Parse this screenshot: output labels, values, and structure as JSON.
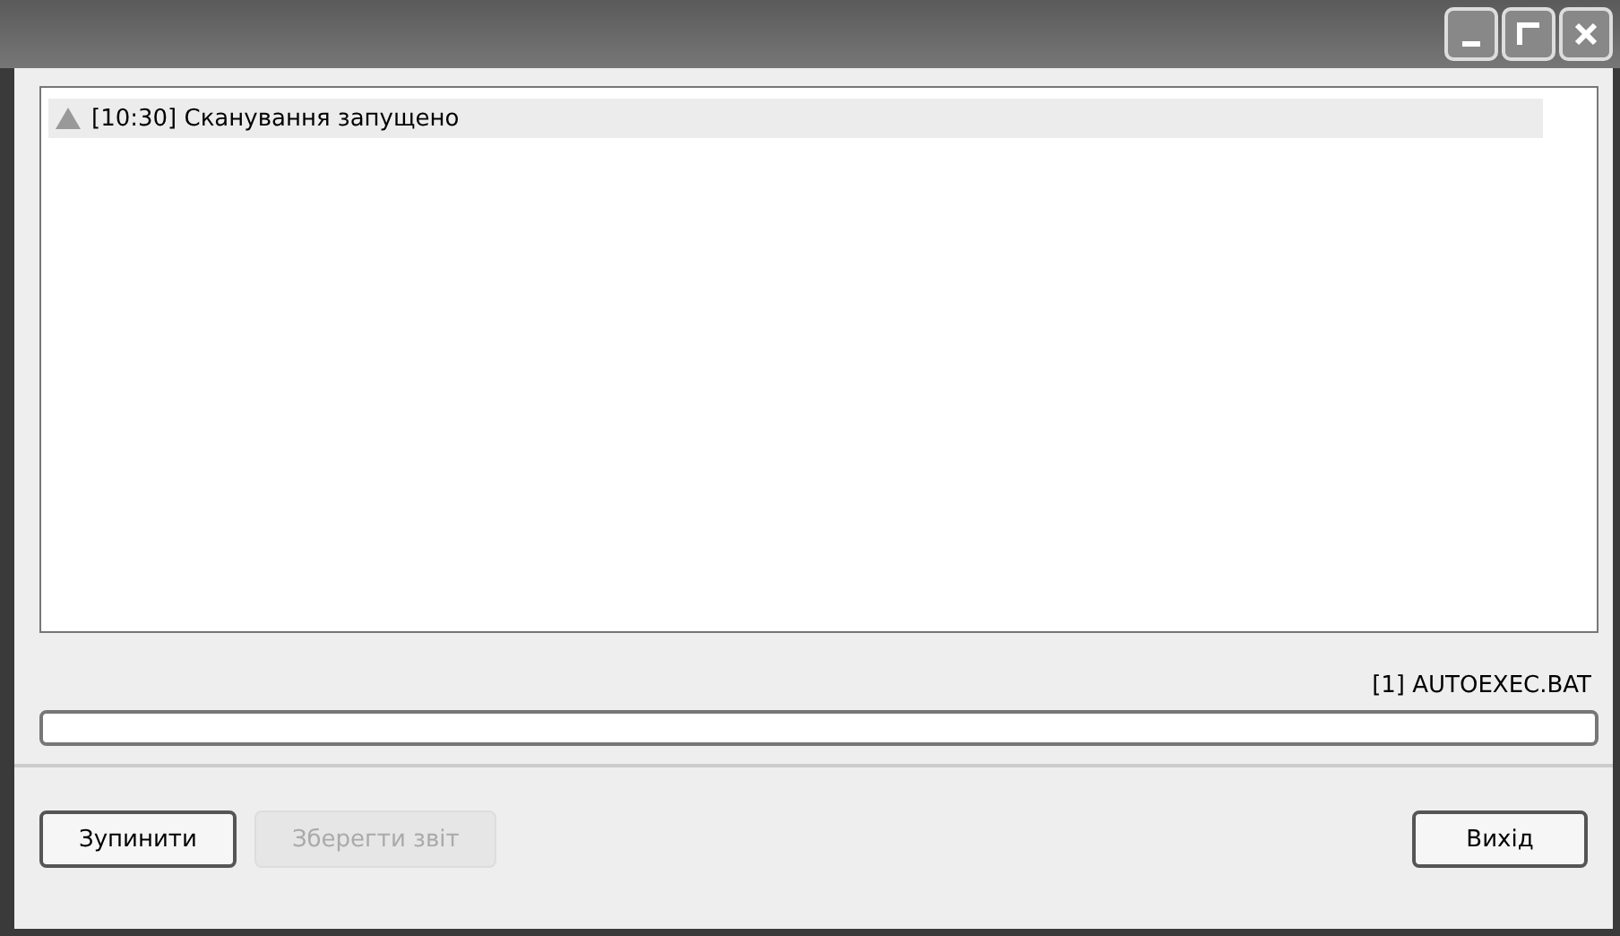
{
  "log": [
    {
      "kind": "warning",
      "text": "[10:30] Сканування запущено",
      "selected": true
    }
  ],
  "status": "[1] AUTOEXEC.BAT",
  "progress": {
    "level": 0
  },
  "buttons": [
    {
      "label": "Зупинити",
      "disabled": false
    },
    {
      "label": "Зберегти звіт",
      "disabled": true
    },
    {
      "label": "Вихід",
      "disabled": false
    }
  ]
}
